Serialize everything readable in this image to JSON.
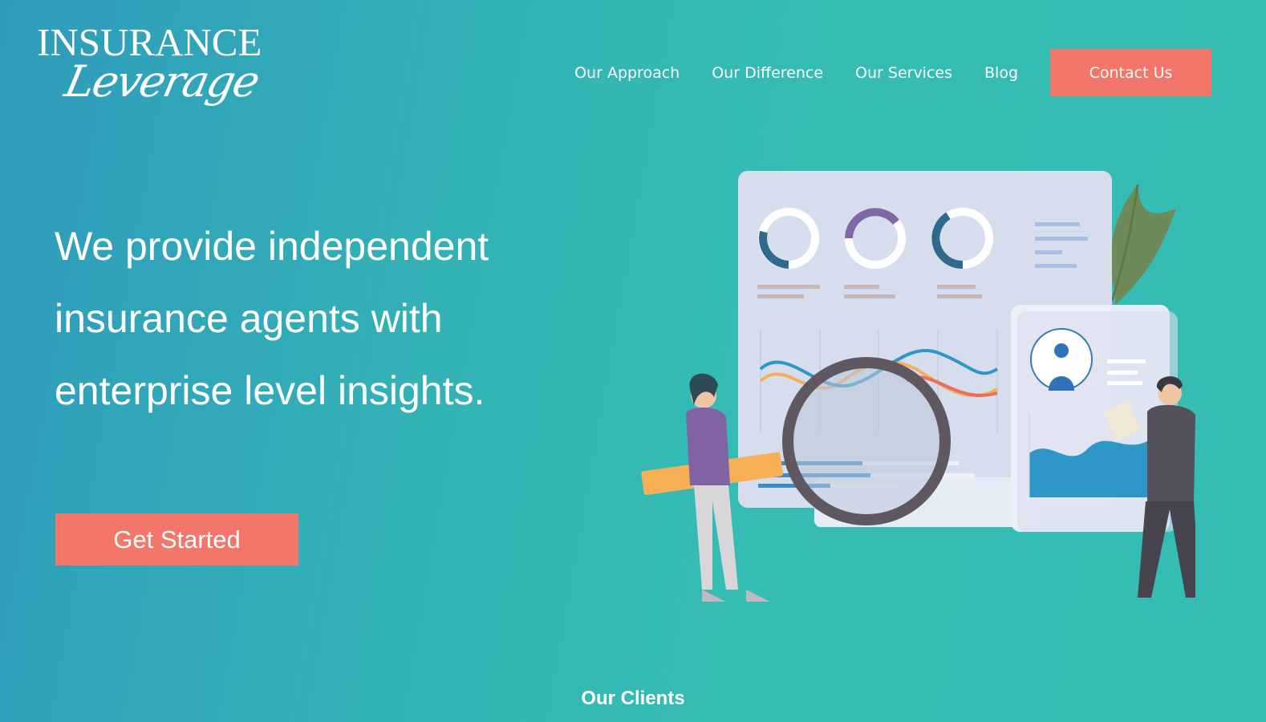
{
  "logo": {
    "line1": "INSURANCE",
    "line2": "Leverage"
  },
  "nav": {
    "items": [
      {
        "label": "Our Approach"
      },
      {
        "label": "Our Difference"
      },
      {
        "label": "Our Services"
      },
      {
        "label": "Blog"
      }
    ],
    "contact_label": "Contact Us"
  },
  "hero": {
    "title": "We provide independent insurance agents with enterprise level insights.",
    "cta_label": "Get Started"
  },
  "clients": {
    "heading": "Our Clients"
  },
  "colors": {
    "accent": "#f2776a",
    "background_teal": "#35bcb3",
    "background_blue": "#2f9bbb"
  },
  "icons": {
    "illustration": "analytics-dashboard-illustration"
  }
}
